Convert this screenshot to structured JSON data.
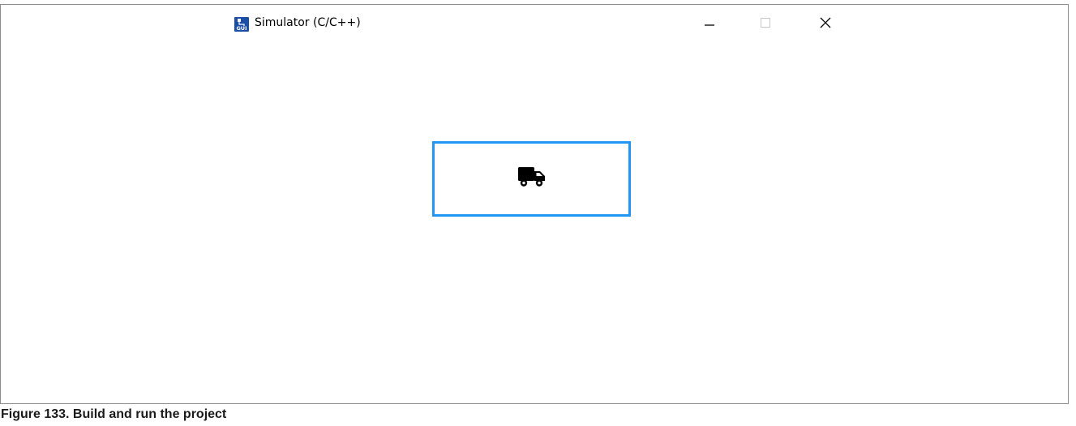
{
  "window": {
    "title": "Simulator (C/C++)",
    "app_icon": "gui-app-icon",
    "controls": {
      "minimize_icon": "minimize-icon",
      "maximize_icon": "maximize-icon",
      "close_icon": "close-icon"
    }
  },
  "content": {
    "button_icon": "truck-icon",
    "button_border_color": "#2196f3"
  },
  "caption": {
    "text": "Figure 133.  Build and run the project"
  }
}
